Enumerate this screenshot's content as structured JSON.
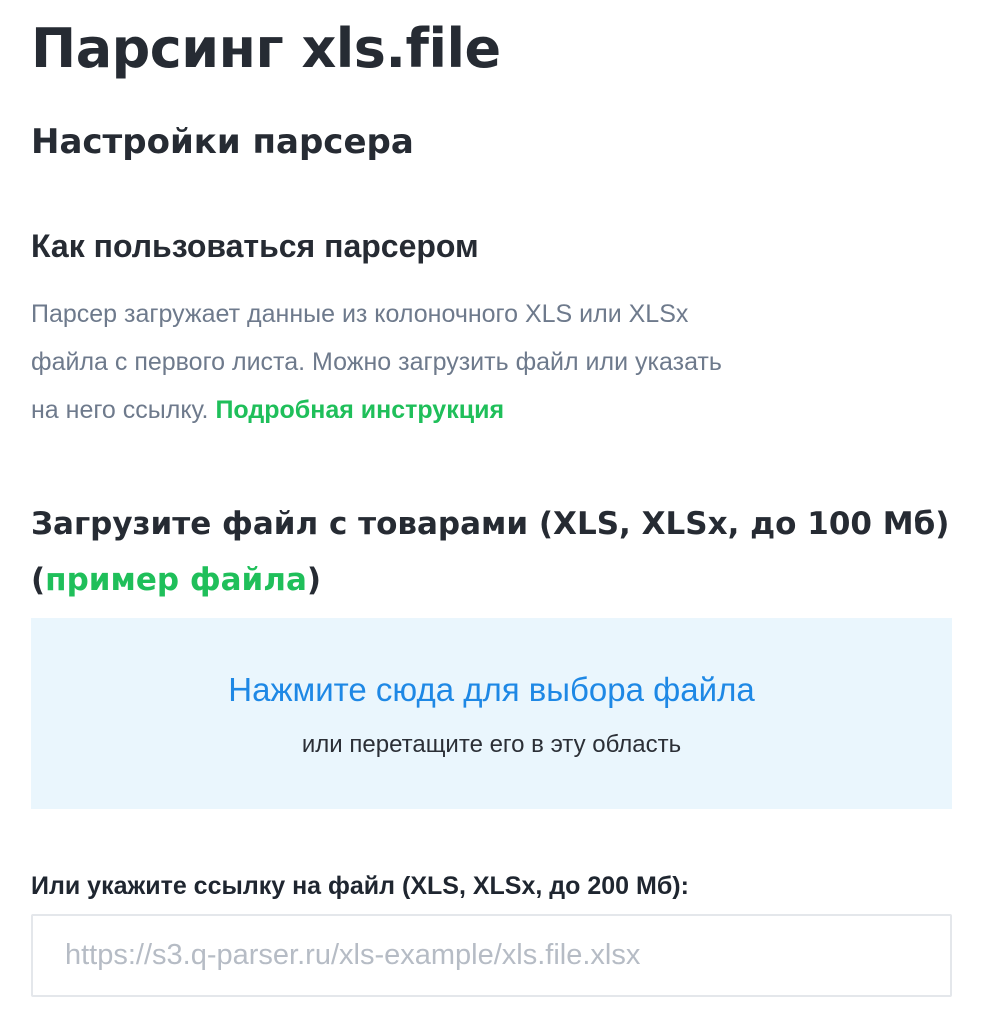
{
  "page": {
    "title": "Парсинг xls.file"
  },
  "settings": {
    "title": "Настройки парсера"
  },
  "howto": {
    "title": "Как пользоваться парсером",
    "line1": "Парсер загружает данные из колоночного XLS или XLSx",
    "line2": "файла с первого листа. Можно загрузить файл или указать",
    "line3_prefix": "на него ссылку. ",
    "instruction_link": "Подробная инструкция"
  },
  "upload": {
    "title_line1": "Загрузите файл с товарами (XLS, XLSx, до 100 Мб)",
    "paren_open": "(",
    "example_link": "пример файла",
    "paren_close": ")",
    "dropzone_main": "Нажмите сюда для выбора файла",
    "dropzone_sub": "или перетащите его в эту область"
  },
  "link": {
    "label": "Или укажите ссылку на файл (XLS, XLSx, до 200 Мб):",
    "placeholder": "https://s3.q-parser.ru/xls-example/xls.file.xlsx",
    "value": ""
  },
  "colors": {
    "heading": "#262b33",
    "body_text": "#6e7a8c",
    "link_green": "#1fbf5a",
    "dropzone_bg": "#eaf6fd",
    "dropzone_link": "#1e88e5",
    "input_border": "#e4e7eb",
    "placeholder": "#b6bcc5"
  }
}
